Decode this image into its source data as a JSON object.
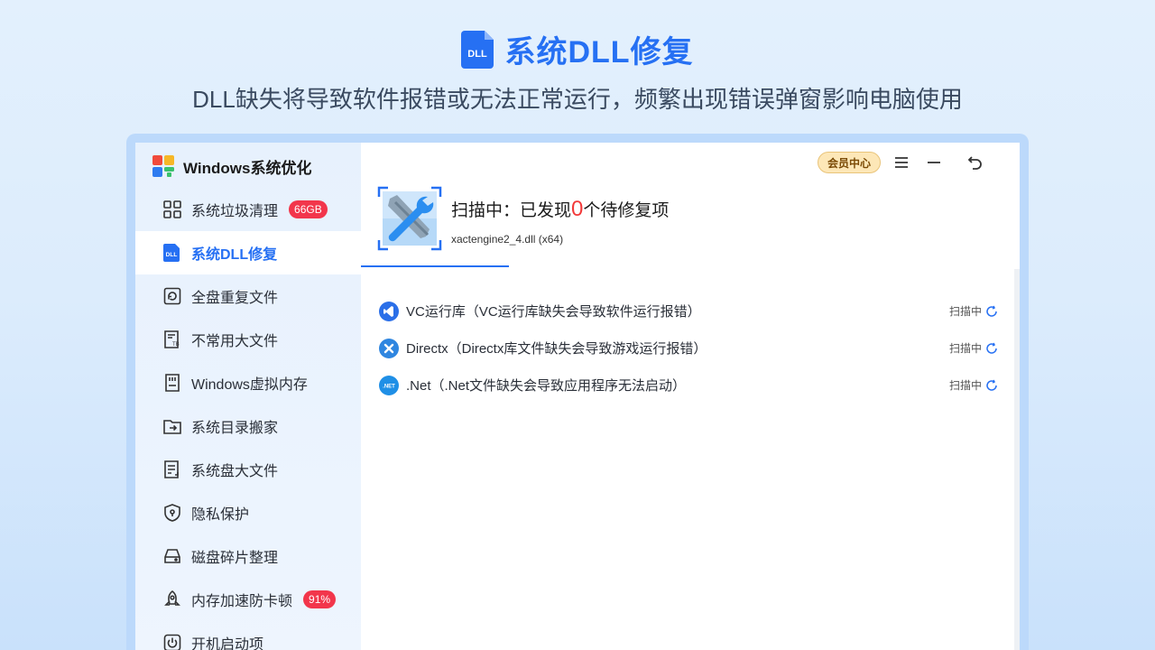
{
  "hero": {
    "title": "系统DLL修复",
    "subtitle": "DLL缺失将导致软件报错或无法正常运行，频繁出现错误弹窗影响电脑使用",
    "icon_text": "DLL"
  },
  "app": {
    "title": "Windows系统优化",
    "vip_label": "会员中心"
  },
  "sidebar": {
    "items": [
      {
        "label": "系统垃圾清理",
        "badge": "66GB",
        "icon": "grid-icon"
      },
      {
        "label": "系统DLL修复",
        "badge": "",
        "icon": "dll-icon",
        "active": true
      },
      {
        "label": "全盘重复文件",
        "badge": "",
        "icon": "duplicate-file-icon"
      },
      {
        "label": "不常用大文件",
        "badge": "",
        "icon": "large-file-icon"
      },
      {
        "label": "Windows虚拟内存",
        "badge": "",
        "icon": "memory-card-icon"
      },
      {
        "label": "系统目录搬家",
        "badge": "",
        "icon": "folder-move-icon"
      },
      {
        "label": "系统盘大文件",
        "badge": "",
        "icon": "disk-file-icon"
      },
      {
        "label": "隐私保护",
        "badge": "",
        "icon": "shield-icon"
      },
      {
        "label": "磁盘碎片整理",
        "badge": "",
        "icon": "disk-icon"
      },
      {
        "label": "内存加速防卡顿",
        "badge": "91%",
        "icon": "rocket-icon"
      },
      {
        "label": "开机启动项",
        "badge": "",
        "icon": "power-icon"
      }
    ]
  },
  "scan": {
    "prefix": "扫描中：已发现",
    "count": "0",
    "suffix": "个待修复项",
    "current_file": "xactengine2_4.dll (x64)"
  },
  "results": [
    {
      "label": "VC运行库（VC运行库缺失会导致软件运行报错）",
      "status": "扫描中",
      "icon": "vc-icon",
      "color": "#2b6fe8"
    },
    {
      "label": "Directx（Directx库文件缺失会导致游戏运行报错）",
      "status": "扫描中",
      "icon": "directx-icon",
      "color": "#2f86e0"
    },
    {
      "label": ".Net（.Net文件缺失会导致应用程序无法启动）",
      "status": "扫描中",
      "icon": "dotnet-icon",
      "color": "#1f8fe6"
    }
  ],
  "colors": {
    "accent": "#2670f3",
    "badge": "#f2364b",
    "count": "#f23a3a"
  }
}
